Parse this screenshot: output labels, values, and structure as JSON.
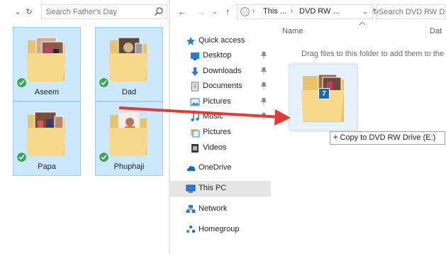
{
  "left_window": {
    "search_placeholder": "Search Father's Day",
    "folders": [
      {
        "label": "Aseem",
        "selected": true,
        "synced": true
      },
      {
        "label": "Dad",
        "selected": true,
        "synced": true
      },
      {
        "label": "Papa",
        "selected": true,
        "synced": true
      },
      {
        "label": "Phuphaji",
        "selected": true,
        "synced": true
      }
    ]
  },
  "right_window": {
    "address": {
      "crumbs": [
        "This ...",
        "DVD RW ..."
      ]
    },
    "search_placeholder": "Search DVD RW Drive (E:)",
    "nav_items": [
      {
        "label": "Quick access",
        "icon": "star-icon",
        "pinned": false
      },
      {
        "label": "Desktop",
        "icon": "desktop-icon",
        "pinned": true
      },
      {
        "label": "Downloads",
        "icon": "download-icon",
        "pinned": true
      },
      {
        "label": "Documents",
        "icon": "documents-icon",
        "pinned": true
      },
      {
        "label": "Pictures",
        "icon": "pictures-icon",
        "pinned": true
      },
      {
        "label": "Music",
        "icon": "music-icon",
        "pinned": true
      },
      {
        "label": "Pictures",
        "icon": "pictures-icon",
        "pinned": false
      },
      {
        "label": "Videos",
        "icon": "videos-icon",
        "pinned": false
      },
      {
        "label": "OneDrive",
        "icon": "onedrive-icon",
        "pinned": false
      },
      {
        "label": "This PC",
        "icon": "computer-icon",
        "pinned": false,
        "selected": true
      },
      {
        "label": "Network",
        "icon": "network-icon",
        "pinned": false
      },
      {
        "label": "Homegroup",
        "icon": "homegroup-icon",
        "pinned": false
      }
    ],
    "columns": {
      "name": "Name",
      "date": "Dat"
    },
    "empty_hint": "Drag files to this folder to add them to the",
    "drag": {
      "item_count": "7",
      "tooltip": "Copy to DVD RW Drive (E:)"
    }
  },
  "colors": {
    "selection_fill": "#cce8ff",
    "selection_border": "#99d1ff",
    "arrow": "#e53935",
    "check": "#3aa65a",
    "badge": "#1e69b5"
  }
}
